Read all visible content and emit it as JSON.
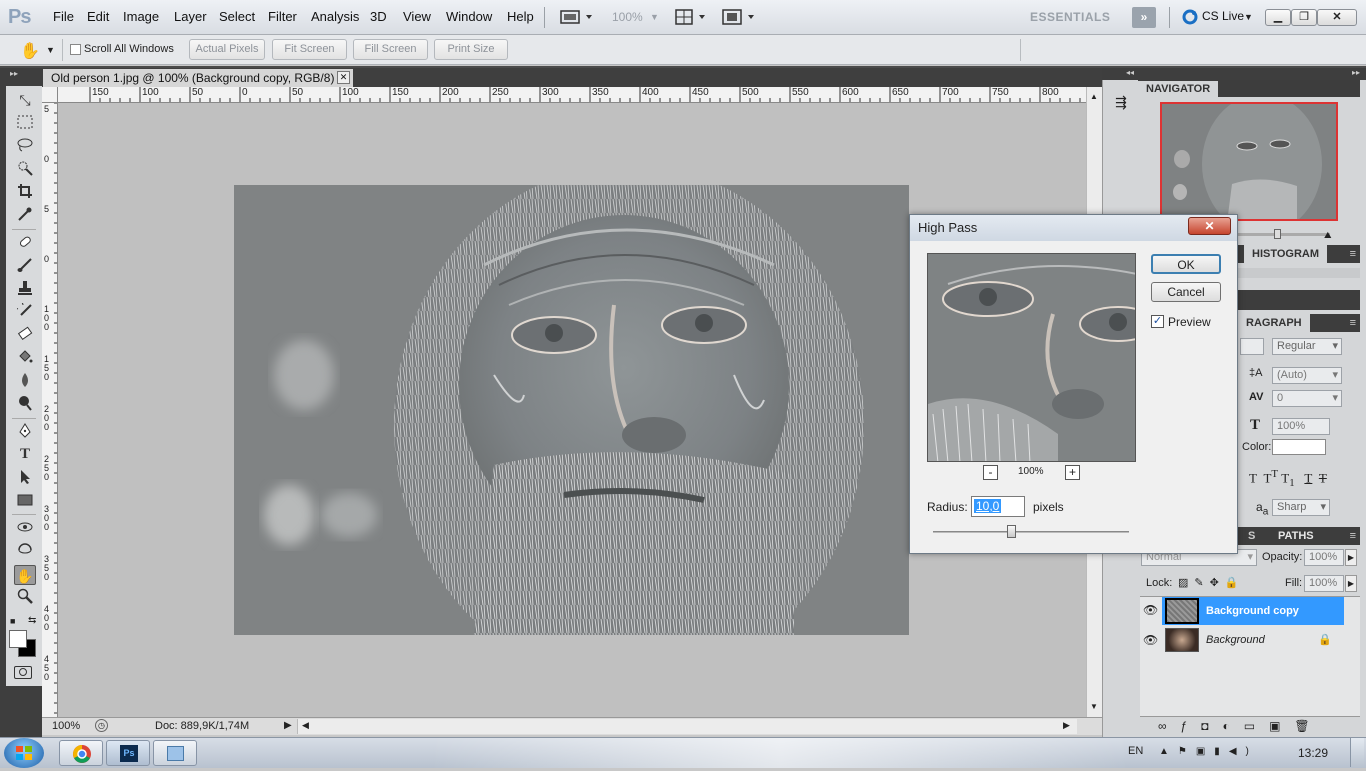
{
  "app": {
    "logo": "Ps",
    "menu": [
      "File",
      "Edit",
      "Image",
      "Layer",
      "Select",
      "Filter",
      "Analysis",
      "3D",
      "View",
      "Window",
      "Help"
    ],
    "zoom_display": "100%",
    "workspace": "ESSENTIALS",
    "more_workspaces": "»",
    "cs_live": "CS Live"
  },
  "options_bar": {
    "scroll_all_windows": "Scroll All Windows",
    "actual_pixels": "Actual Pixels",
    "fit_screen": "Fit Screen",
    "fill_screen": "Fill Screen",
    "print_size": "Print Size"
  },
  "document": {
    "tab_title": "Old person 1.jpg @ 100% (Background copy, RGB/8) *",
    "ruler_h": [
      "150",
      "100",
      "50",
      "0",
      "50",
      "100",
      "150",
      "200",
      "250",
      "300",
      "350",
      "400",
      "450",
      "500",
      "550",
      "600",
      "650",
      "700",
      "750",
      "800"
    ],
    "ruler_v": [
      "5",
      "0",
      "5",
      "0",
      "1 0 0",
      "1 5 0",
      "2 0 0",
      "2 5 0",
      "3 0 0",
      "3 5 0",
      "4 0 0",
      "4 5 0"
    ],
    "status_zoom": "100%",
    "status_doc": "Doc: 889,9K/1,74M"
  },
  "dialog": {
    "title": "High Pass",
    "ok": "OK",
    "cancel": "Cancel",
    "preview_label": "Preview",
    "preview_checked": true,
    "zoom_minus": "-",
    "zoom_percent": "100%",
    "zoom_plus": "+",
    "radius_label": "Radius:",
    "radius_value": "10,0",
    "radius_unit": "pixels",
    "radius_slider_fraction": 0.4
  },
  "panels": {
    "navigator": "NAVIGATOR",
    "histogram": "HISTOGRAM",
    "paragraph": "RAGRAPH",
    "font_style": "Regular",
    "leading": "(Auto)",
    "tracking": "0",
    "vertical_scale": "100%",
    "color_label": "Color:",
    "antialias": "Sharp",
    "antialias_prefix": "a",
    "paths_tab": "PATHS",
    "s_tab": "S",
    "blend_mode": "Normal",
    "opacity_label": "Opacity:",
    "opacity": "100%",
    "lock_label": "Lock:",
    "fill_label": "Fill:",
    "fill": "100%",
    "layers": [
      {
        "name": "Background copy",
        "selected": true
      },
      {
        "name": "Background",
        "selected": false,
        "locked": true
      }
    ]
  },
  "taskbar": {
    "lang": "EN",
    "time": "13:29"
  },
  "colors": {
    "selection_blue": "#3399ff",
    "dialog_close_red": "#c6452e"
  }
}
